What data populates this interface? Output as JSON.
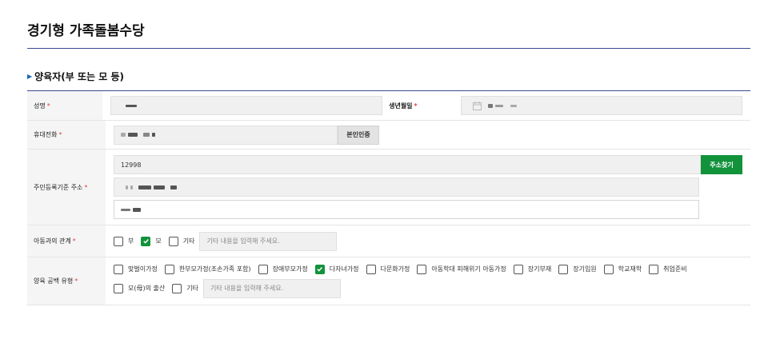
{
  "page": {
    "title": "경기형 가족돌봄수당"
  },
  "section": {
    "title": "양육자(부 또는 모 등)"
  },
  "labels": {
    "name": "성명",
    "birth": "생년월일",
    "phone": "휴대전화",
    "address": "주민등록기준 주소",
    "relation": "아동과의 관계",
    "family_type": "양육 공백 유형",
    "required_mark": "*"
  },
  "fields": {
    "zipcode": "12998",
    "verify_button": "본인인증",
    "address_button": "주소찾기"
  },
  "relation": {
    "options": [
      {
        "label": "부",
        "checked": false
      },
      {
        "label": "모",
        "checked": true
      },
      {
        "label": "기타",
        "checked": false
      }
    ],
    "etc_placeholder": "기타 내용을 입력해 주세요."
  },
  "family_type": {
    "options_row1": [
      {
        "label": "맞벌이가정",
        "checked": false
      },
      {
        "label": "한부모가정(조손가족 포함)",
        "checked": false
      },
      {
        "label": "장애부모가정",
        "checked": false
      },
      {
        "label": "다자녀가정",
        "checked": true
      },
      {
        "label": "다문화가정",
        "checked": false
      },
      {
        "label": "아동학대 피해위기 아동가정",
        "checked": false
      },
      {
        "label": "장기부재",
        "checked": false
      },
      {
        "label": "장기입원",
        "checked": false
      },
      {
        "label": "학교재학",
        "checked": false
      },
      {
        "label": "취업준비",
        "checked": false
      }
    ],
    "options_row2": [
      {
        "label": "모(母)의 출산",
        "checked": false
      },
      {
        "label": "기타",
        "checked": false
      }
    ],
    "etc_placeholder": "기타 내용을 입력해 주세요."
  },
  "colors": {
    "accent": "#12923b",
    "rule": "#3b4a8f",
    "required": "#e04040"
  }
}
